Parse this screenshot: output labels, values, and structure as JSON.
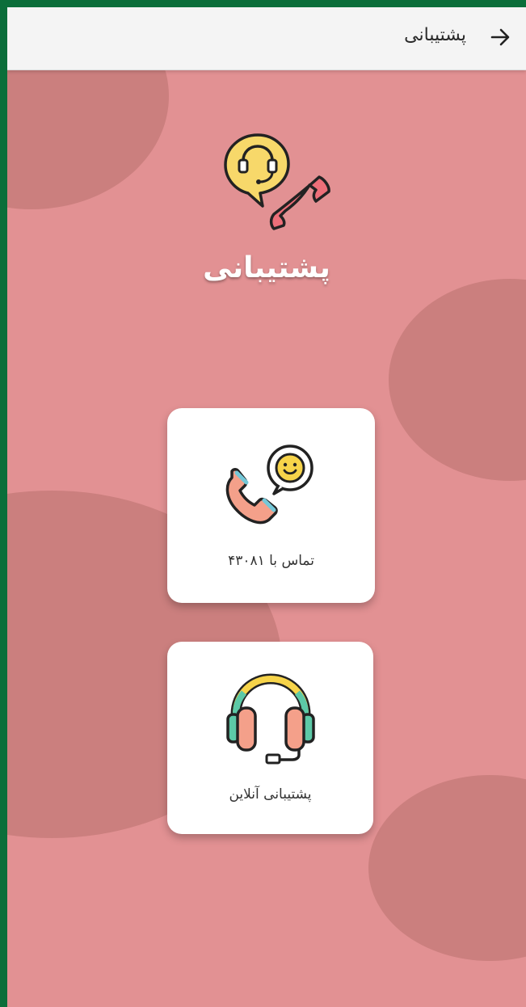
{
  "appbar": {
    "title": "پشتیبانی",
    "back_icon": "arrow-right-icon"
  },
  "hero": {
    "title": "پشتیبانی",
    "icon": "support-chat-phone-icon"
  },
  "options": [
    {
      "label": "تماس با ۴۳۰۸۱",
      "icon": "phone-smile-icon"
    },
    {
      "label": "پشتیبانی آنلاین",
      "icon": "headset-icon"
    }
  ],
  "colors": {
    "background": "#e29193",
    "blobs": "#cb7f7e",
    "frame": "#0b6e3a",
    "appbar": "#f4f4f4",
    "card": "#ffffff"
  }
}
